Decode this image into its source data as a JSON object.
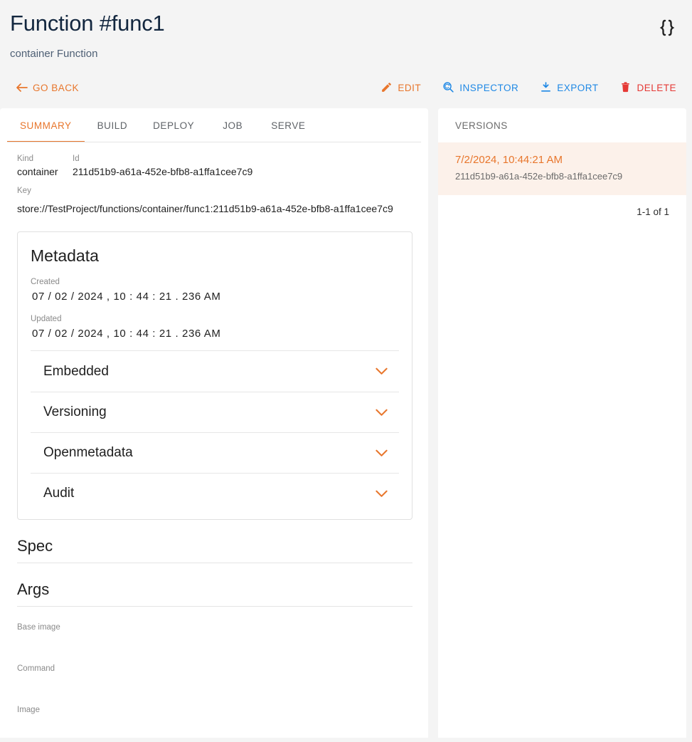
{
  "header": {
    "title": "Function #func1",
    "subtitle": "container Function",
    "json_icon": "curly-braces-icon"
  },
  "actionbar": {
    "go_back": "GO BACK",
    "back_icon": "arrow-left-icon",
    "actions": [
      {
        "label": "EDIT",
        "icon": "pencil-icon",
        "color": "#e8762c"
      },
      {
        "label": "INSPECTOR",
        "icon": "inspect-icon",
        "color": "#1e88e5"
      },
      {
        "label": "EXPORT",
        "icon": "download-icon",
        "color": "#1e88e5"
      },
      {
        "label": "DELETE",
        "icon": "trash-icon",
        "color": "#e53935"
      }
    ]
  },
  "tabs": [
    {
      "label": "SUMMARY",
      "active": true
    },
    {
      "label": "BUILD",
      "active": false
    },
    {
      "label": "DEPLOY",
      "active": false
    },
    {
      "label": "JOB",
      "active": false
    },
    {
      "label": "SERVE",
      "active": false
    }
  ],
  "summary": {
    "kind_label": "Kind",
    "kind_value": "container",
    "id_label": "Id",
    "id_value": "211d51b9-a61a-452e-bfb8-a1ffa1cee7c9",
    "key_label": "Key",
    "key_value": "store://TestProject/functions/container/func1:211d51b9-a61a-452e-bfb8-a1ffa1cee7c9"
  },
  "metadata": {
    "title": "Metadata",
    "created_label": "Created",
    "created_value": "07 / 02 / 2024 ,  10 : 44 : 21 . 236   AM",
    "updated_label": "Updated",
    "updated_value": "07 / 02 / 2024 ,  10 : 44 : 21 . 236   AM",
    "accordions": [
      {
        "title": "Embedded",
        "icon": "chevron-down-icon"
      },
      {
        "title": "Versioning",
        "icon": "chevron-down-icon"
      },
      {
        "title": "Openmetadata",
        "icon": "chevron-down-icon"
      },
      {
        "title": "Audit",
        "icon": "chevron-down-icon"
      }
    ]
  },
  "spec": {
    "title": "Spec"
  },
  "args": {
    "title": "Args",
    "fields": [
      {
        "label": "Base image",
        "value": ""
      },
      {
        "label": "Command",
        "value": ""
      },
      {
        "label": "Image",
        "value": ""
      }
    ]
  },
  "versions": {
    "heading": "VERSIONS",
    "items": [
      {
        "date": "7/2/2024, 10:44:21 AM",
        "id": "211d51b9-a61a-452e-bfb8-a1ffa1cee7c9",
        "selected": true
      }
    ],
    "pagination": "1-1 of 1"
  },
  "colors": {
    "accent": "#e8762c",
    "blue": "#1e88e5",
    "red": "#e53935",
    "title": "#13273f",
    "page_bg": "#f4f4f4",
    "version_selected_bg": "#fcf1ea"
  }
}
